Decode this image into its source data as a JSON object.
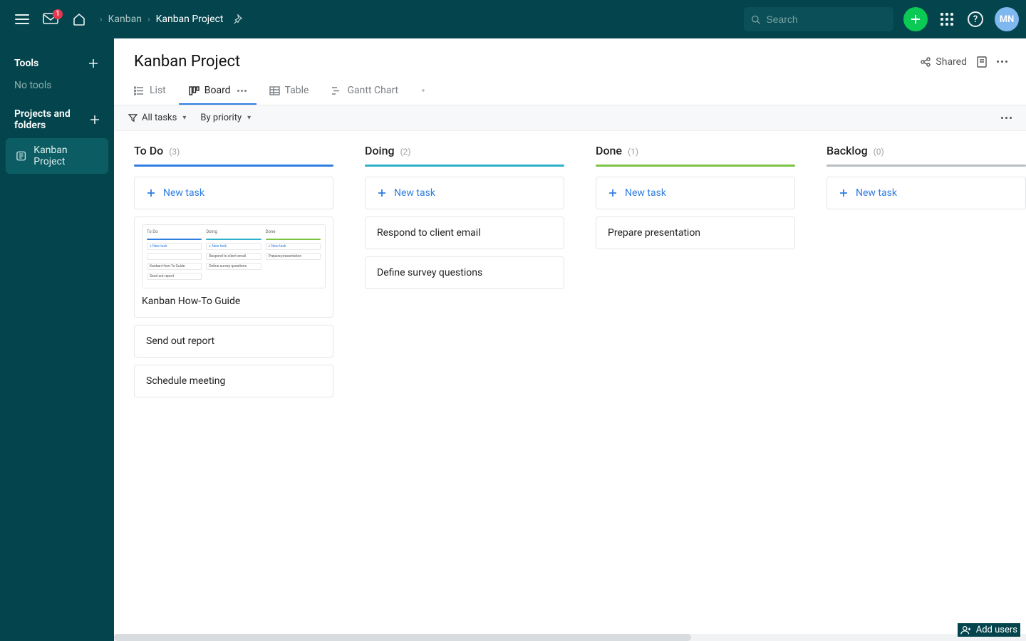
{
  "top": {
    "inbox_badge": "1",
    "breadcrumb": [
      "Kanban",
      "Kanban Project"
    ],
    "search_placeholder": "Search",
    "avatar_initials": "MN"
  },
  "sidebar": {
    "tools_heading": "Tools",
    "tools_empty": "No tools",
    "projects_heading": "Projects and folders",
    "project_item": "Kanban Project"
  },
  "page_title": "Kanban Project",
  "shared_label": "Shared",
  "tabs": {
    "list": "List",
    "board": "Board",
    "table": "Table",
    "gantt": "Gantt Chart"
  },
  "filters": {
    "all_tasks": "All tasks",
    "by_priority": "By priority"
  },
  "newtask_label": "New task",
  "columns": [
    {
      "name": "To Do",
      "count": 3,
      "color": "c-blue",
      "cards": [
        {
          "title": "Kanban How-To Guide",
          "thumb": true
        },
        {
          "title": "Send out report"
        },
        {
          "title": "Schedule meeting"
        }
      ]
    },
    {
      "name": "Doing",
      "count": 2,
      "color": "c-teal",
      "cards": [
        {
          "title": "Respond to client email"
        },
        {
          "title": "Define survey questions"
        }
      ]
    },
    {
      "name": "Done",
      "count": 1,
      "color": "c-green",
      "cards": [
        {
          "title": "Prepare presentation"
        }
      ]
    },
    {
      "name": "Backlog",
      "count": 0,
      "color": "c-grey",
      "cards": []
    }
  ],
  "add_users_label": "Add users"
}
